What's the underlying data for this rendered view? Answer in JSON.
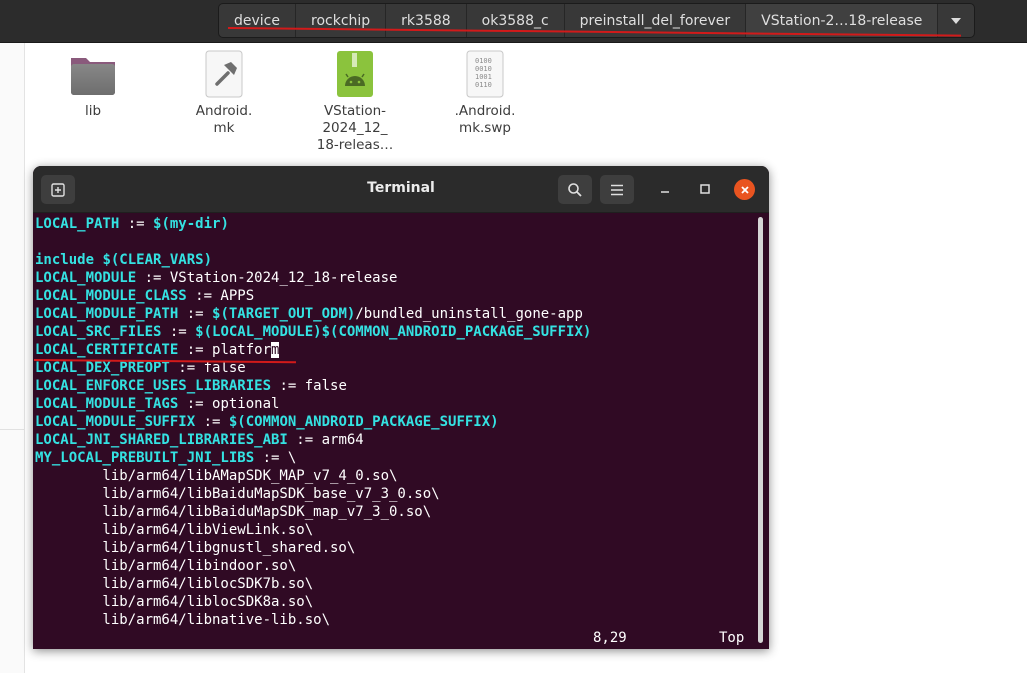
{
  "breadcrumb": {
    "items": [
      "device",
      "rockchip",
      "rk3588",
      "ok3588_c",
      "preinstall_del_forever",
      "VStation-2…18-release"
    ]
  },
  "files": [
    {
      "name": "lib",
      "icon": "folder-icon"
    },
    {
      "name": "Android.\nmk",
      "icon": "makefile-icon"
    },
    {
      "name": "VStation-\n2024_12_\n18-releas…",
      "icon": "apk-icon"
    },
    {
      "name": ".Android.\nmk.swp",
      "icon": "binary-file-icon"
    }
  ],
  "terminal": {
    "title": "Terminal",
    "lines": [
      [
        {
          "t": "LOCAL_PATH",
          "k": true
        },
        {
          "t": " := "
        },
        {
          "t": "$(my-dir)",
          "k": true
        }
      ],
      [],
      [
        {
          "t": "include",
          "k": true
        },
        {
          "t": " "
        },
        {
          "t": "$(CLEAR_VARS)",
          "k": true
        }
      ],
      [
        {
          "t": "LOCAL_MODULE",
          "k": true
        },
        {
          "t": " := VStation-2024_12_18-release"
        }
      ],
      [
        {
          "t": "LOCAL_MODULE_CLASS",
          "k": true
        },
        {
          "t": " := APPS"
        }
      ],
      [
        {
          "t": "LOCAL_MODULE_PATH",
          "k": true
        },
        {
          "t": " := "
        },
        {
          "t": "$(TARGET_OUT_ODM)",
          "k": true
        },
        {
          "t": "/bundled_uninstall_gone-app"
        }
      ],
      [
        {
          "t": "LOCAL_SRC_FILES",
          "k": true
        },
        {
          "t": " := "
        },
        {
          "t": "$(LOCAL_MODULE)$(COMMON_ANDROID_PACKAGE_SUFFIX)",
          "k": true
        }
      ],
      [
        {
          "t": "LOCAL_CERTIFICATE",
          "k": true
        },
        {
          "t": " := platfor"
        },
        {
          "t": "m",
          "c": true
        }
      ],
      [
        {
          "t": "LOCAL_DEX_PREOPT",
          "k": true
        },
        {
          "t": " := false"
        }
      ],
      [
        {
          "t": "LOCAL_ENFORCE_USES_LIBRARIES",
          "k": true
        },
        {
          "t": " := false"
        }
      ],
      [
        {
          "t": "LOCAL_MODULE_TAGS",
          "k": true
        },
        {
          "t": " := optional"
        }
      ],
      [
        {
          "t": "LOCAL_MODULE_SUFFIX",
          "k": true
        },
        {
          "t": " := "
        },
        {
          "t": "$(COMMON_ANDROID_PACKAGE_SUFFIX)",
          "k": true
        }
      ],
      [
        {
          "t": "LOCAL_JNI_SHARED_LIBRARIES_ABI",
          "k": true
        },
        {
          "t": " := arm64"
        }
      ],
      [
        {
          "t": "MY_LOCAL_PREBUILT_JNI_LIBS",
          "k": true
        },
        {
          "t": " := \\"
        }
      ],
      [
        {
          "t": "        lib/arm64/libAMapSDK_MAP_v7_4_0.so\\"
        }
      ],
      [
        {
          "t": "        lib/arm64/libBaiduMapSDK_base_v7_3_0.so\\"
        }
      ],
      [
        {
          "t": "        lib/arm64/libBaiduMapSDK_map_v7_3_0.so\\"
        }
      ],
      [
        {
          "t": "        lib/arm64/libViewLink.so\\"
        }
      ],
      [
        {
          "t": "        lib/arm64/libgnustl_shared.so\\"
        }
      ],
      [
        {
          "t": "        lib/arm64/libindoor.so\\"
        }
      ],
      [
        {
          "t": "        lib/arm64/liblocSDK7b.so\\"
        }
      ],
      [
        {
          "t": "        lib/arm64/liblocSDK8a.so\\"
        }
      ],
      [
        {
          "t": "        lib/arm64/libnative-lib.so\\"
        }
      ]
    ],
    "status_position": "8,29",
    "status_scroll": "Top"
  },
  "colors": {
    "terminal_bg": "#300a24",
    "keyword": "#34e2e2",
    "close_button": "#e95420",
    "annotation_red": "#d21a1a"
  }
}
